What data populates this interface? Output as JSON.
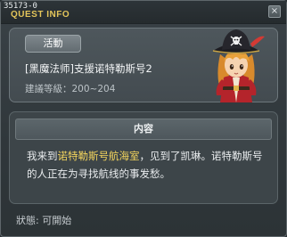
{
  "window": {
    "quest_id": "35173-0",
    "title": "QUEST INFO",
    "close_glyph": "×"
  },
  "summary": {
    "badge": "活動",
    "quest_name": "[黑魔法师]支援诺特勒斯号2",
    "level_req": "建議等級：200~204",
    "portrait_icon": "pirate-captain-portrait"
  },
  "content": {
    "header": "内容",
    "text_before": "我来到",
    "highlight": "诺特勒斯号航海室",
    "text_after": "，见到了凯琳。诺特勒斯号的人正在为寻找航线的事发愁。"
  },
  "footer": {
    "status": "狀態:  可開始"
  },
  "colors": {
    "title_gold": "#e3c55a",
    "highlight_gold": "#f4d55d",
    "panel": "#4e575c",
    "background": "#30373b"
  }
}
